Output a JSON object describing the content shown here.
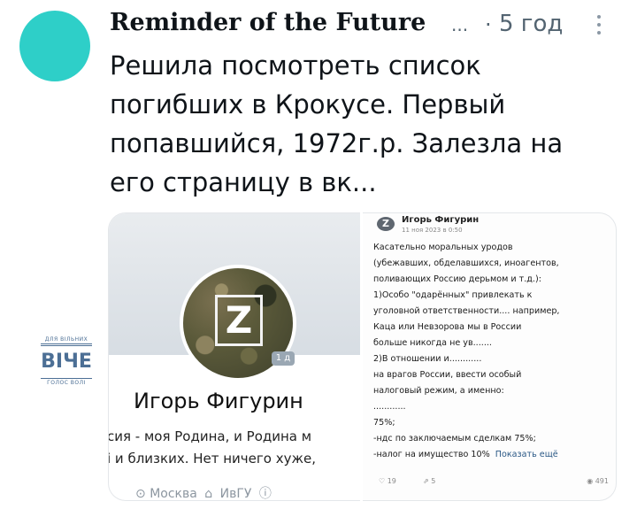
{
  "tweet": {
    "author": "Reminder of the Future",
    "ellipsis": "...",
    "dot": "·",
    "time": "5 год",
    "text_lines": [
      "Решила посмотреть список",
      "погибших в Крокусе. Первый",
      "попавшийся, 1972г.р. Залезла на",
      "его страницу в вк..."
    ],
    "avatar_color": "#2ecfc8"
  },
  "media": {
    "profile": {
      "name": "Игорь Фигурин",
      "days_badge": "1 д",
      "bio_lines": [
        "сия - моя Родина, и Родина м",
        "і и близких. Нет ничего хуже,"
      ],
      "city": "Москва",
      "university": "ИвГУ",
      "info_icon": "ⓘ"
    },
    "post": {
      "author": "Игорь Фигурин",
      "date": "11 ноя 2023 в 0:50",
      "body_lines": [
        "Касательно моральных уродов",
        "(убежавших, обделавшихся, иноагентов,",
        "поливающих Россию дерьмом и т.д.):",
        "1)Особо \"одарённых\" привлекать к",
        "уголовной ответственности.... например,",
        "Каца или Невзорова мы в России",
        "больше никогда не ув.......",
        "2)В отношении и............",
        "на врагов России, ввести особый",
        "налоговый режим, а именно:",
        "............",
        "75%;",
        "-ндс по заключаемым сделкам 75%;",
        "-налог на имущество 10%"
      ],
      "show_more": "Показать ещё",
      "likes": "19",
      "reposts": "5",
      "views": "491"
    }
  },
  "watermark": {
    "top": "ДЛЯ ВІЛЬНИХ",
    "main": "ВІЧЕ",
    "bottom": "ГОЛОС ВОЛІ"
  }
}
